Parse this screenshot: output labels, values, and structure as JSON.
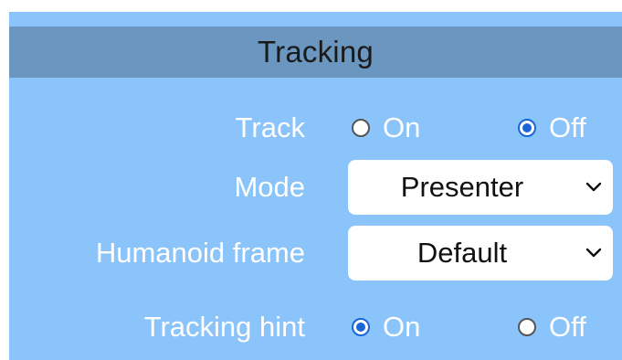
{
  "section": {
    "title": "Tracking"
  },
  "rows": {
    "track": {
      "label": "Track",
      "options": [
        {
          "label": "On",
          "checked": false
        },
        {
          "label": "Off",
          "checked": true
        }
      ]
    },
    "mode": {
      "label": "Mode",
      "value": "Presenter",
      "icon": "chevron-down-icon"
    },
    "humanoid_frame": {
      "label": "Humanoid frame",
      "value": "Default",
      "icon": "chevron-down-icon"
    },
    "tracking_hint": {
      "label": "Tracking hint",
      "options": [
        {
          "label": "On",
          "checked": true
        },
        {
          "label": "Off",
          "checked": false
        }
      ]
    }
  },
  "colors": {
    "panel_bg": "#8ac4fa",
    "header_bg": "#6a96bf",
    "radio_checked": "#1a66d8",
    "label_text": "#ffffff"
  }
}
